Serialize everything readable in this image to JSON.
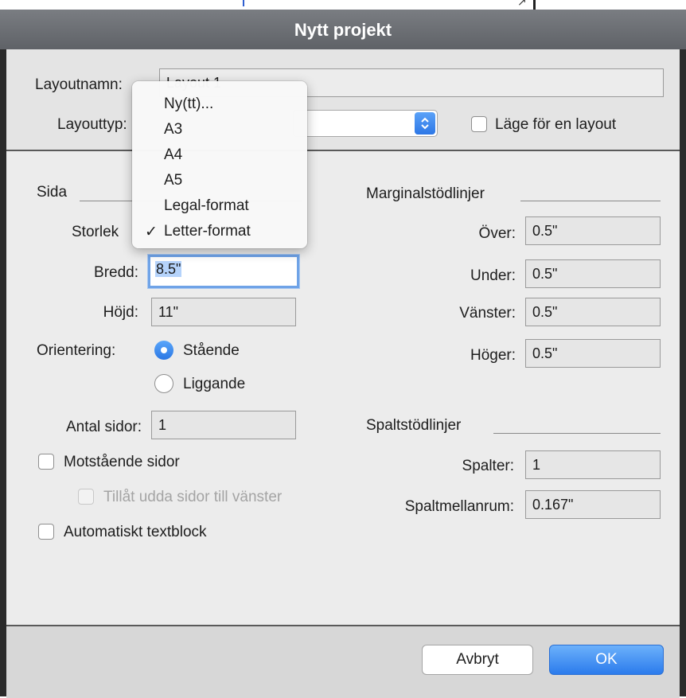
{
  "window": {
    "title": "Nytt projekt"
  },
  "layout": {
    "name_label": "Layoutnamn:",
    "name_value": "Layout 1",
    "type_label": "Layouttyp:",
    "single_layout_label": "Läge för en layout"
  },
  "page": {
    "section_label": "Sida",
    "size_label": "Storlek",
    "width_label": "Bredd:",
    "width_value": "8.5\"",
    "height_label": "Höjd:",
    "height_value": "11\"",
    "orientation_label": "Orientering:",
    "portrait_label": "Stående",
    "landscape_label": "Liggande",
    "orientation_selected": "Stående",
    "page_count_label": "Antal sidor:",
    "page_count_value": "1",
    "facing_pages_label": "Motstående sidor",
    "allow_odd_left_label": "Tillåt udda sidor till vänster",
    "auto_textbox_label": "Automatiskt textblock"
  },
  "margins": {
    "section_label": "Marginalstödlinjer",
    "top_label": "Över:",
    "top_value": "0.5\"",
    "bottom_label": "Under:",
    "bottom_value": "0.5\"",
    "left_label": "Vänster:",
    "left_value": "0.5\"",
    "right_label": "Höger:",
    "right_value": "0.5\""
  },
  "columns": {
    "section_label": "Spaltstödlinjer",
    "columns_label": "Spalter:",
    "columns_value": "1",
    "gutter_label": "Spaltmellanrum:",
    "gutter_value": "0.167\""
  },
  "size_menu": {
    "items": [
      "Ny(tt)...",
      "A3",
      "A4",
      "A5",
      "Legal-format",
      "Letter-format"
    ],
    "selected": "Letter-format",
    "check_mark": "✓"
  },
  "buttons": {
    "cancel": "Avbryt",
    "ok": "OK"
  },
  "colors": {
    "accent": "#2d77e6",
    "titlebar": "#6b6e73",
    "sheet": "#ececec"
  }
}
